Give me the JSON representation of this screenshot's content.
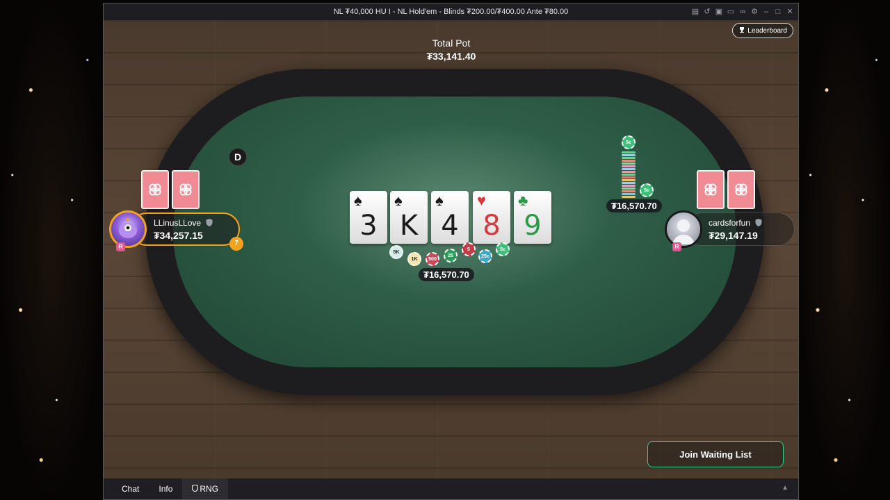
{
  "window": {
    "title": "NL ₮40,000 HU I - NL Hold'em - Blinds ₮200.00/₮400.00 Ante ₮80.00"
  },
  "header": {
    "leaderboard_label": "Leaderboard"
  },
  "pot": {
    "title": "Total Pot",
    "value": "₮33,141.40"
  },
  "dealer_button_label": "D",
  "board": [
    {
      "rank": "3",
      "suit": "♠",
      "color": "black"
    },
    {
      "rank": "K",
      "suit": "♠",
      "color": "black"
    },
    {
      "rank": "4",
      "suit": "♠",
      "color": "black"
    },
    {
      "rank": "8",
      "suit": "♥",
      "color": "red"
    },
    {
      "rank": "9",
      "suit": "♣",
      "color": "green"
    }
  ],
  "center_bet": {
    "amount": "₮16,570.70",
    "chips": [
      "5K",
      "1K",
      "500",
      "25",
      "5",
      "25c",
      "5c"
    ]
  },
  "players": [
    {
      "name": "LLinusLLove",
      "stack": "₮34,257.15",
      "timer": "7",
      "badge": "R"
    },
    {
      "name": "cardsforfun",
      "stack": "₮29,147.19",
      "badge": "R"
    }
  ],
  "right_bet": {
    "amount": "₮16,570.70",
    "chip_top_label": "5c",
    "chip_side_label": "5c"
  },
  "actions": {
    "join_waiting_list": "Join Waiting List"
  },
  "bottom_tabs": [
    "Chat",
    "Info",
    "RNG"
  ],
  "colors": {
    "accent_active": "#f2a21c",
    "join_border": "#2bd48a",
    "card_back": "#f08a93",
    "felt": "#2f5e48"
  }
}
